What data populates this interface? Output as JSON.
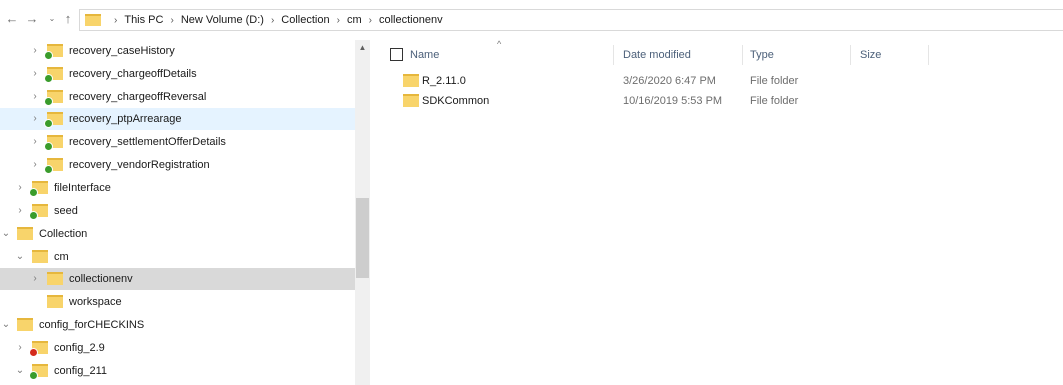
{
  "nav": {
    "back_icon": "←",
    "forward_icon": "→",
    "recent_icon": "⌄",
    "up_icon": "↑"
  },
  "breadcrumb": [
    "This PC",
    "New Volume (D:)",
    "Collection",
    "cm",
    "collectionenv"
  ],
  "tree": {
    "items": [
      {
        "label": "recovery_caseHistory",
        "status": "ok",
        "expand": "›"
      },
      {
        "label": "recovery_chargeoffDetails",
        "status": "ok",
        "expand": "›"
      },
      {
        "label": "recovery_chargeoffReversal",
        "status": "ok",
        "expand": "›"
      },
      {
        "label": "recovery_ptpArrearage",
        "status": "ok",
        "expand": "›"
      },
      {
        "label": "recovery_settlementOfferDetails",
        "status": "ok",
        "expand": "›"
      },
      {
        "label": "recovery_vendorRegistration",
        "status": "ok",
        "expand": "›"
      },
      {
        "label": "fileInterface",
        "status": "ok",
        "expand": "›"
      },
      {
        "label": "seed",
        "status": "ok",
        "expand": "›"
      },
      {
        "label": "Collection",
        "status": "none",
        "expand": "⌄"
      },
      {
        "label": "cm",
        "status": "none",
        "expand": "⌄"
      },
      {
        "label": "collectionenv",
        "status": "none",
        "expand": "›"
      },
      {
        "label": "workspace",
        "status": "none",
        "expand": ""
      },
      {
        "label": "config_forCHECKINS",
        "status": "none",
        "expand": "⌄"
      },
      {
        "label": "config_2.9",
        "status": "err",
        "expand": "›"
      },
      {
        "label": "config_211",
        "status": "ok",
        "expand": "⌄"
      }
    ]
  },
  "columns": {
    "name": "Name",
    "date_modified": "Date modified",
    "type": "Type",
    "size": "Size",
    "sort_icon": "^"
  },
  "files": [
    {
      "name": "R_2.11.0",
      "date": "3/26/2020 6:47 PM",
      "type": "File folder",
      "size": ""
    },
    {
      "name": "SDKCommon",
      "date": "10/16/2019 5:53 PM",
      "type": "File folder",
      "size": ""
    }
  ],
  "scrollbar": {
    "up_icon": "▲"
  },
  "colors": {
    "hover": "#e5f3ff",
    "selected": "#d9d9d9",
    "folder": "#f8d46b",
    "sync_ok": "#3a9c2c",
    "sync_error": "#d42b1d"
  }
}
